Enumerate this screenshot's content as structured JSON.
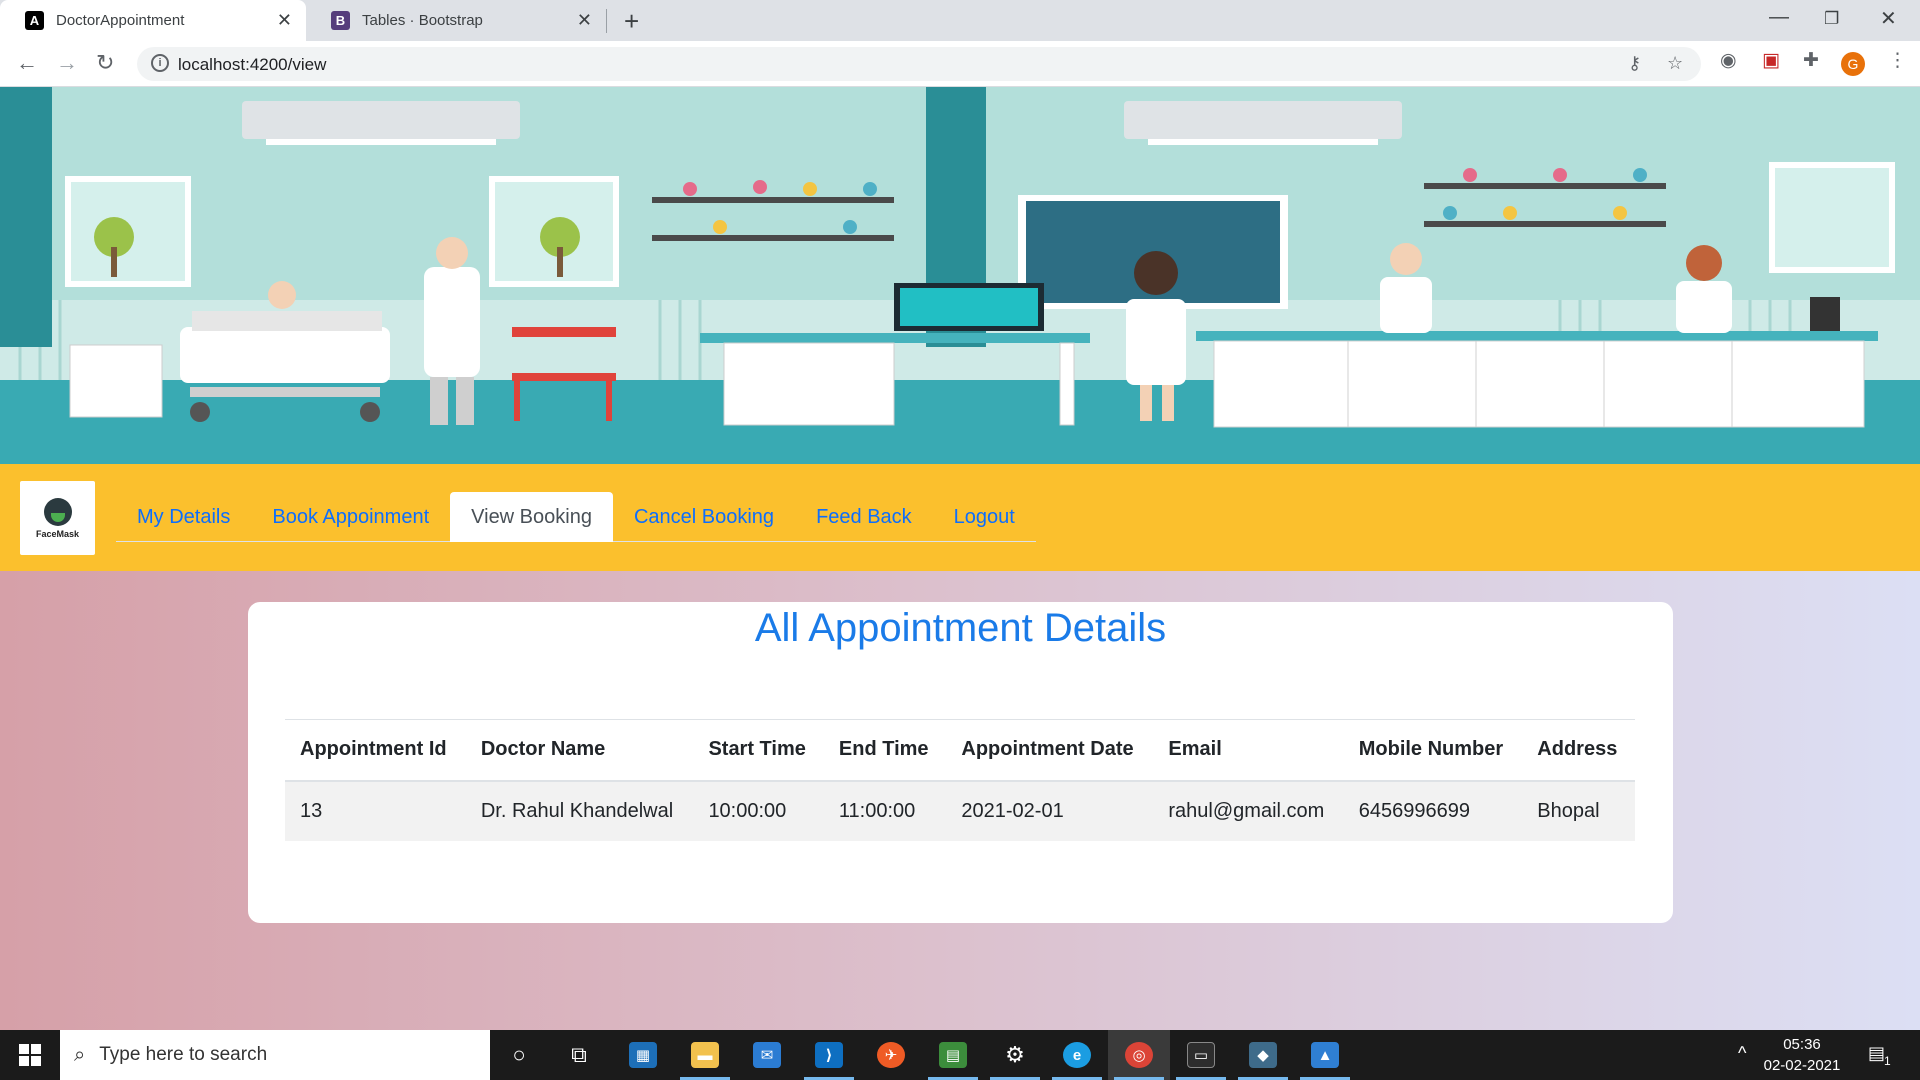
{
  "browser": {
    "tabs": [
      {
        "title": "DoctorAppointment",
        "favicon": "angular-icon",
        "active": true
      },
      {
        "title": "Tables · Bootstrap",
        "favicon": "bootstrap-icon",
        "active": false
      }
    ],
    "url": "localhost:4200/view",
    "profile_initial": "G"
  },
  "app": {
    "logo_text": "FaceMask",
    "nav": [
      {
        "label": "My Details",
        "active": false
      },
      {
        "label": "Book Appoinment",
        "active": false
      },
      {
        "label": "View Booking",
        "active": true
      },
      {
        "label": "Cancel Booking",
        "active": false
      },
      {
        "label": "Feed Back",
        "active": false
      },
      {
        "label": "Logout",
        "active": false
      }
    ],
    "heading": "All Appointment Details",
    "table": {
      "headers": [
        "Appointment Id",
        "Doctor Name",
        "Start Time",
        "End Time",
        "Appointment Date",
        "Email",
        "Mobile Number",
        "Address"
      ],
      "rows": [
        [
          "13",
          "Dr. Rahul Khandelwal",
          "10:00:00",
          "11:00:00",
          "2021-02-01",
          "rahul@gmail.com",
          "6456996699",
          "Bhopal"
        ]
      ]
    },
    "colors": {
      "navbar": "#fbc02d",
      "link": "#0d6efd",
      "heading": "#1a7be8"
    }
  },
  "taskbar": {
    "search_placeholder": "Type here to search",
    "time": "05:36",
    "date": "02-02-2021",
    "notification_count": "1"
  }
}
